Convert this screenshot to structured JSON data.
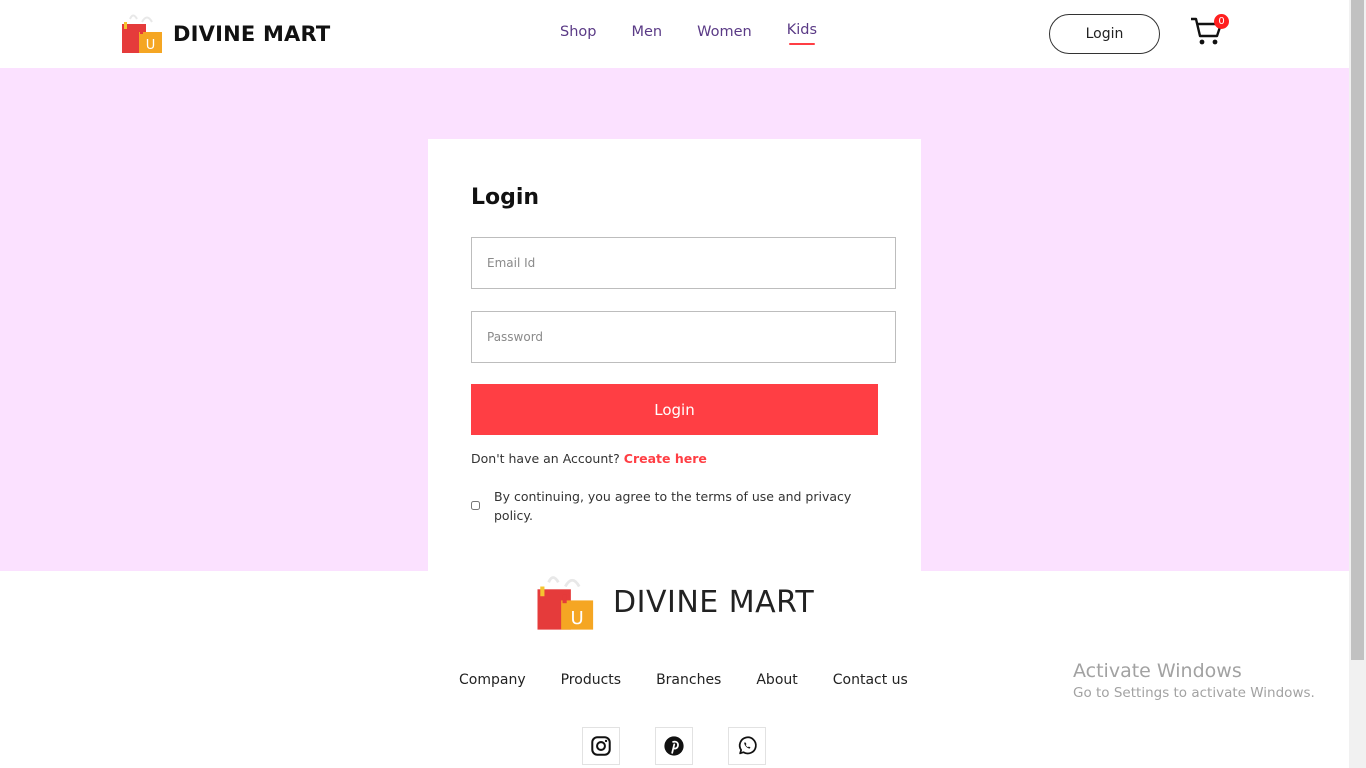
{
  "header": {
    "brand": "DIVINE MART",
    "nav": [
      "Shop",
      "Men",
      "Women",
      "Kids"
    ],
    "active_nav": "Kids",
    "login_label": "Login",
    "cart_count": "0"
  },
  "login_form": {
    "title": "Login",
    "email_placeholder": "Email Id",
    "email_value": "",
    "password_placeholder": "Password",
    "password_value": "",
    "submit_label": "Login",
    "signup_prompt": "Don't have an Account?",
    "signup_link": "Create here",
    "terms_text": "By continuing, you agree to the terms of use and privacy policy.",
    "terms_checked": false
  },
  "footer": {
    "brand": "DIVINE MART",
    "links": [
      "Company",
      "Products",
      "Branches",
      "About",
      "Contact us"
    ],
    "social": [
      "instagram-icon",
      "pinterest-icon",
      "whatsapp-icon"
    ]
  },
  "system": {
    "activate_title": "Activate Windows",
    "activate_sub": "Go to Settings to activate Windows."
  },
  "colors": {
    "accent": "#ff3e44",
    "hero_bg": "#fbe1ff",
    "nav_text": "#5a3a86"
  }
}
